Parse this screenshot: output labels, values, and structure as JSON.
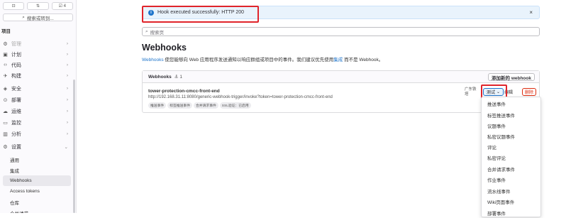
{
  "sidebar": {
    "top_buttons": [
      "⊡",
      "⇅",
      "☑ 4"
    ],
    "search_label": "搜索或转到...",
    "group_label": "项目",
    "items": [
      {
        "label": "管理",
        "icon": "gear"
      },
      {
        "label": "计划",
        "icon": "calendar"
      },
      {
        "label": "代码",
        "icon": "code"
      },
      {
        "label": "构建",
        "icon": "rocket"
      },
      {
        "label": "安全",
        "icon": "shield"
      },
      {
        "label": "部署",
        "icon": "deploy"
      },
      {
        "label": "运维",
        "icon": "cloud"
      },
      {
        "label": "监控",
        "icon": "monitor"
      },
      {
        "label": "分析",
        "icon": "chart"
      },
      {
        "label": "设置",
        "icon": "settings"
      }
    ],
    "sub_items": [
      "通用",
      "集成",
      "Webhooks",
      "Access tokens",
      "仓库",
      "合并请求"
    ],
    "active_sub": "Webhooks"
  },
  "alert": {
    "text": "Hook executed successfully: HTTP 200",
    "close": "×"
  },
  "search": {
    "placeholder": "搜索页"
  },
  "page": {
    "title": "Webhooks",
    "desc_link1": "Webhooks",
    "desc_middle": " 使您能够向 Web 应用程序发送通知以响应群组或项目中的事件。我们建议优先使用",
    "desc_link2": "集成",
    "desc_end": " 而不是 Webhook。"
  },
  "card": {
    "header_label": "Webhooks",
    "count": "1",
    "add_button": "添加新的 webhook",
    "hook_name": "tower-protection-cmcc-front-end",
    "hook_url": "http://192.168.31.11:8080/generic-webhook-trigger/invoke?token=tower-protection-cmcc-front-end",
    "badges": [
      "推送事件",
      "标签推送事件",
      "合并请求事件",
      "SSL验证：已启用"
    ],
    "project_label": "广东铁塔",
    "test_button": "测试",
    "edit_button": "编辑",
    "delete_button": "删除"
  },
  "dropdown": {
    "items": [
      "推送事件",
      "标签推送事件",
      "议题事件",
      "私密议题事件",
      "评论",
      "私密评论",
      "合并请求事件",
      "作业事件",
      "流水线事件",
      "Wiki页面事件",
      "部署事件"
    ]
  },
  "colors": {
    "accent": "#1f75cb",
    "danger": "#dd2b0e",
    "highlight": "#e0242b"
  }
}
